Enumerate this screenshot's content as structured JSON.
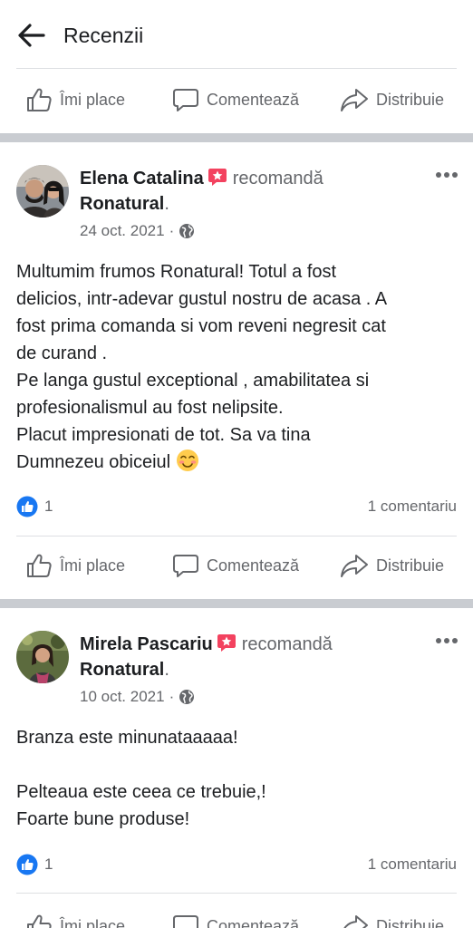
{
  "header": {
    "title": "Recenzii"
  },
  "actions": {
    "like": "Îmi place",
    "comment": "Comentează",
    "share": "Distribuie"
  },
  "posts": [
    {
      "author": "Elena Catalina",
      "recommends": "recomandă",
      "page": "Ronatural",
      "page_dot": ".",
      "date": "24 oct. 2021",
      "dot": "·",
      "body_lines": [
        "Multumim frumos Ronatural! Totul a fost",
        "delicios, intr-adevar gustul nostru de acasa . A",
        "fost prima comanda si vom reveni negresit cat",
        "de curand .",
        "Pe langa gustul exceptional , amabilitatea si",
        "profesionalismul au fost nelipsite.",
        "Placut impresionati de tot. Sa va tina",
        "Dumnezeu obiceiul"
      ],
      "reactions": "1",
      "comments": "1 comentariu"
    },
    {
      "author": "Mirela Pascariu",
      "recommends": "recomandă",
      "page": "Ronatural",
      "page_dot": ".",
      "date": "10 oct. 2021",
      "dot": "·",
      "body_lines": [
        "Branza este minunataaaaa!",
        "",
        "Pelteaua este ceea ce trebuie,!",
        "Foarte bune produse!"
      ],
      "reactions": "1",
      "comments": "1 comentariu"
    }
  ],
  "colors": {
    "secondary_text": "#65676b",
    "like_blue": "#1877f2",
    "recommend_red": "#f3425f",
    "separator": "#c9ccd1"
  }
}
